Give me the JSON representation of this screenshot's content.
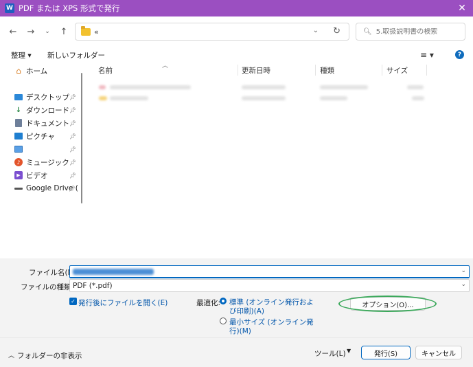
{
  "window": {
    "title": "PDF または XPS 形式で発行",
    "app_icon": "W"
  },
  "nav": {
    "breadcrumb": "«",
    "search_placeholder": "5.取扱説明書の検索"
  },
  "toolbar": {
    "organize": "整理 ▾",
    "new_folder": "新しいフォルダー"
  },
  "sidebar": {
    "items": [
      {
        "label": "ホーム",
        "icon": "home-icon"
      },
      {
        "label": "デスクトップ",
        "icon": "desktop-icon"
      },
      {
        "label": "ダウンロード",
        "icon": "download-icon"
      },
      {
        "label": "ドキュメント",
        "icon": "document-icon"
      },
      {
        "label": "ピクチャ",
        "icon": "picture-icon"
      },
      {
        "label": "",
        "icon": "gallery-icon"
      },
      {
        "label": "ミュージック",
        "icon": "music-icon"
      },
      {
        "label": "ビデオ",
        "icon": "video-icon"
      },
      {
        "label": "Google Drive (",
        "icon": "drive-icon"
      }
    ]
  },
  "columns": {
    "name": "名前",
    "date": "更新日時",
    "type": "種類",
    "size": "サイズ"
  },
  "form": {
    "filename_label": "ファイル名(N):",
    "filetype_label": "ファイルの種類(T):",
    "filetype_value": "PDF (*.pdf)",
    "open_after": "発行後にファイルを開く(E)",
    "optimize_label": "最適化:",
    "opt_standard_line1": "標準 (オンライン発行およ",
    "opt_standard_line2": "び印刷)(A)",
    "opt_min_line1": "最小サイズ (オンライン発",
    "opt_min_line2": "行)(M)",
    "options_button": "オプション(O)..."
  },
  "footer": {
    "hide_folders": "フォルダーの非表示",
    "tools": "ツール(L)",
    "publish": "発行(S)",
    "cancel": "キャンセル"
  }
}
